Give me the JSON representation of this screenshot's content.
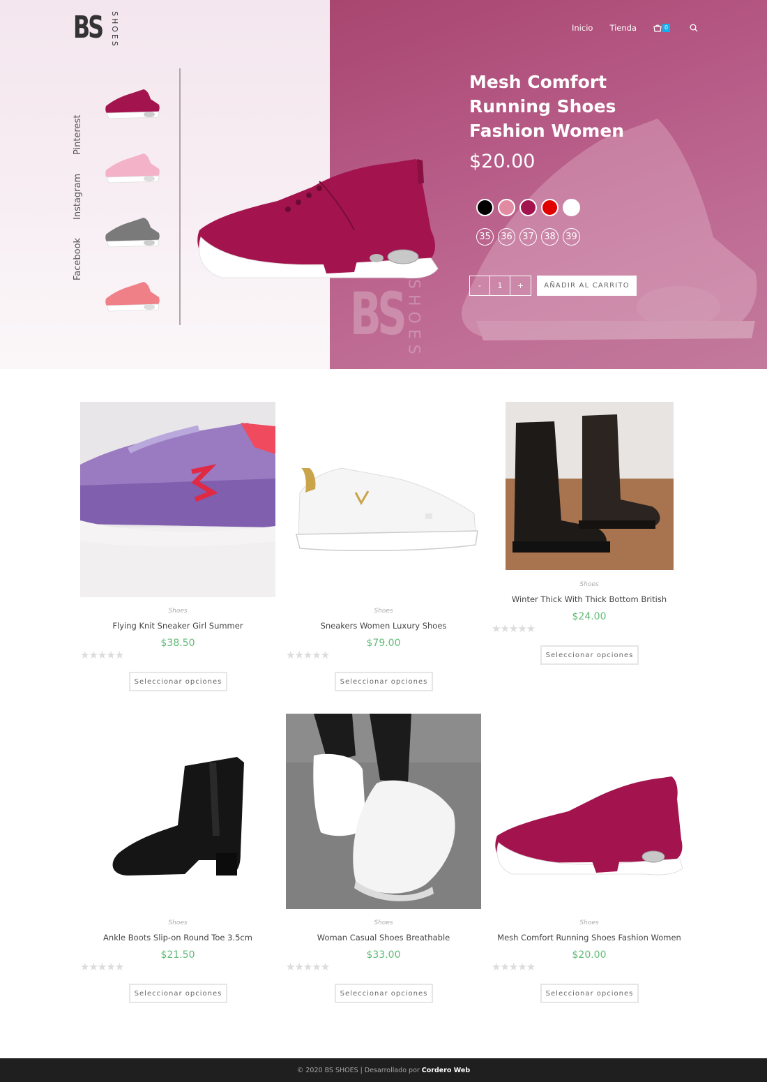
{
  "brand": {
    "logo_main": "BS",
    "logo_sub": "SHOES"
  },
  "nav": {
    "home": "Inicio",
    "shop": "Tienda",
    "cart_count": "0"
  },
  "social": [
    "Facebook",
    "Instagram",
    "Pinterest"
  ],
  "hero": {
    "title": "Mesh Comfort Running Shoes Fashion Women",
    "price": "$20.00",
    "colors": [
      "#000000",
      "#e38aa3",
      "#a3144f",
      "#e00000",
      "#ffffff"
    ],
    "sizes": [
      "35",
      "36",
      "37",
      "38",
      "39"
    ],
    "qty_minus": "-",
    "qty_value": "1",
    "qty_plus": "+",
    "add_to_cart": "AÑADIR AL CARRITO",
    "thumb_colors": [
      "#a3144f",
      "#f3b2c8",
      "#7a7a7a",
      "#f08088"
    ],
    "watermark_main": "BS",
    "watermark_sub": "SHOES"
  },
  "products": [
    {
      "category": "Shoes",
      "name": "Flying Knit Sneaker Girl Summer",
      "price": "$38.50",
      "button": "Seleccionar opciones",
      "stars": "★★★★★"
    },
    {
      "category": "Shoes",
      "name": "Sneakers Women Luxury Shoes",
      "price": "$79.00",
      "button": "Seleccionar opciones",
      "stars": "★★★★★"
    },
    {
      "category": "Shoes",
      "name": "Winter Thick With Thick Bottom British",
      "price": "$24.00",
      "button": "Seleccionar opciones",
      "stars": "★★★★★"
    },
    {
      "category": "Shoes",
      "name": "Ankle Boots Slip-on Round Toe 3.5cm",
      "price": "$21.50",
      "button": "Seleccionar opciones",
      "stars": "★★★★★"
    },
    {
      "category": "Shoes",
      "name": "Woman Casual Shoes Breathable",
      "price": "$33.00",
      "button": "Seleccionar opciones",
      "stars": "★★★★★"
    },
    {
      "category": "Shoes",
      "name": "Mesh Comfort Running Shoes Fashion Women",
      "price": "$20.00",
      "button": "Seleccionar opciones",
      "stars": "★★★★★"
    }
  ],
  "footer": {
    "text": "© 2020 BS SHOES | Desarrollado por",
    "credit": "Cordero Web"
  }
}
